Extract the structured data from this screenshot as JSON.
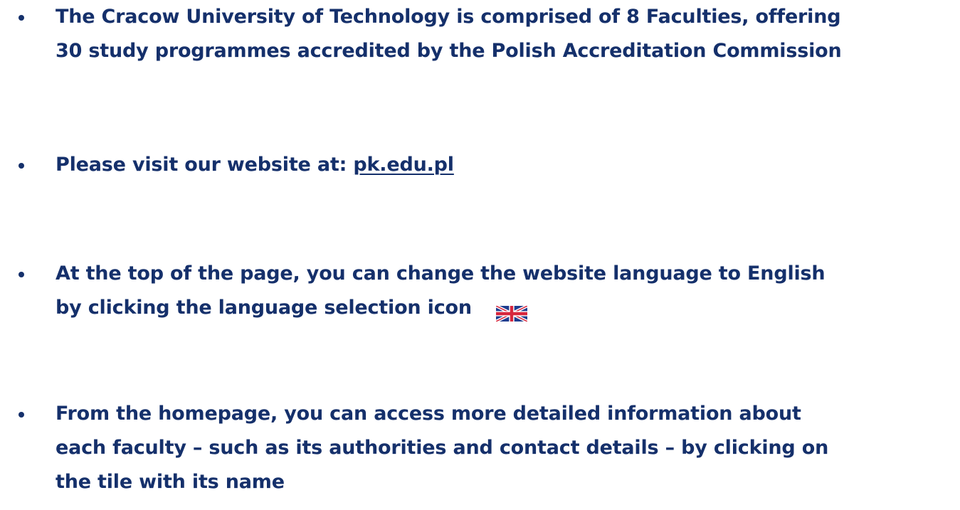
{
  "items": [
    {
      "lines": [
        "The Cracow University of Technology is comprised of 8 Faculties, offering",
        "30 study programmes accredited by the Polish Accreditation Commission"
      ]
    },
    {
      "prefix": "Please visit our website at: ",
      "link_text": "pk.edu.pl"
    },
    {
      "lines": [
        "At the top of the page, you can change the website language to English",
        "by clicking the language selection icon"
      ],
      "icon": "uk-flag-icon"
    },
    {
      "lines": [
        "From the homepage, you can access more detailed information about",
        "each faculty – such as its authorities and contact details – by clicking on",
        "the tile with its name"
      ]
    }
  ],
  "colors": {
    "text": "#15306b",
    "flag_blue": "#1f3d8f",
    "flag_red": "#d7263d",
    "background": "#ffffff"
  }
}
